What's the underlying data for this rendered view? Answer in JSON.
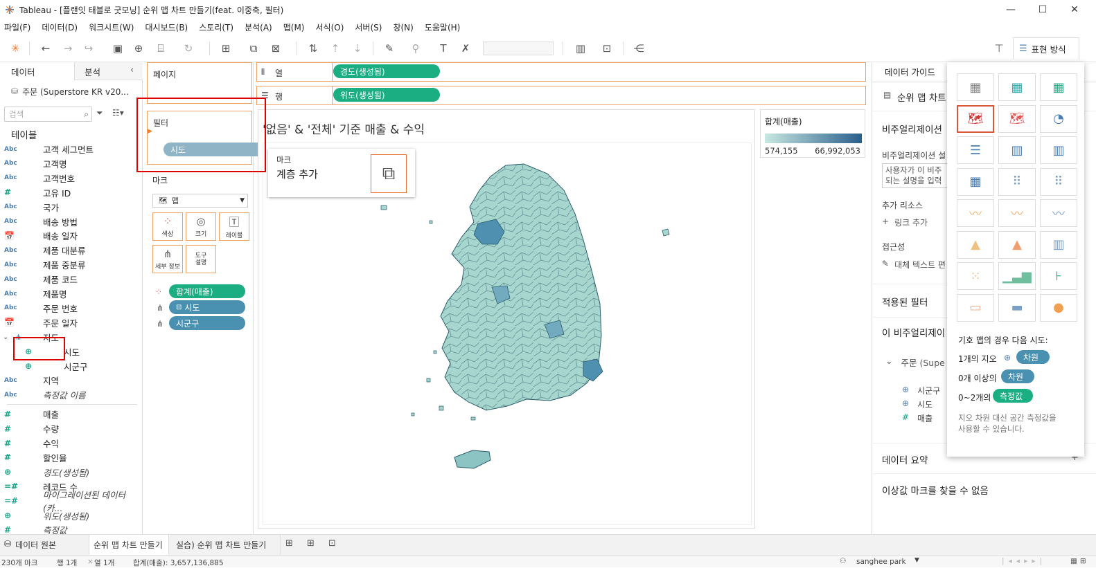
{
  "window": {
    "title": "Tableau - [플랜잇 태블로 굿모닝] 순위 맵 차트 만들기(feat. 이중축, 필터)"
  },
  "menu": [
    "파일(F)",
    "데이터(D)",
    "워크시트(W)",
    "대시보드(B)",
    "스토리(T)",
    "분석(A)",
    "맵(M)",
    "서식(O)",
    "서버(S)",
    "창(N)",
    "도움말(H)"
  ],
  "toolbar": {
    "show_me_label": "표현 방식"
  },
  "left_panel": {
    "tab_data": "데이터",
    "tab_analysis": "분석",
    "datasource": "주문 (Superstore KR v20...",
    "search_placeholder": "검색",
    "tables_title": "테이블",
    "fields": [
      {
        "icon": "Abc",
        "label": "고객 세그먼트"
      },
      {
        "icon": "Abc",
        "label": "고객명"
      },
      {
        "icon": "Abc",
        "label": "고객번호"
      },
      {
        "icon": "#",
        "label": "고유 ID"
      },
      {
        "icon": "Abc",
        "label": "국가"
      },
      {
        "icon": "Abc",
        "label": "배송 방법"
      },
      {
        "icon": "calendar",
        "label": "배송 일자"
      },
      {
        "icon": "Abc",
        "label": "제품 대분류"
      },
      {
        "icon": "Abc",
        "label": "제품 중분류"
      },
      {
        "icon": "Abc",
        "label": "제품 코드"
      },
      {
        "icon": "Abc",
        "label": "제품명"
      },
      {
        "icon": "Abc",
        "label": "주문 번호"
      },
      {
        "icon": "calendar",
        "label": "주문 일자"
      }
    ],
    "hierarchy": {
      "label": "지도",
      "children": [
        "시도",
        "시군구"
      ]
    },
    "fields2": [
      {
        "icon": "Abc",
        "label": "지역",
        "italic": false
      },
      {
        "icon": "Abc",
        "label": "측정값 이름",
        "italic": true
      }
    ],
    "measures": [
      {
        "icon": "#",
        "label": "매출",
        "italic": false
      },
      {
        "icon": "#",
        "label": "수량",
        "italic": false
      },
      {
        "icon": "#",
        "label": "수익",
        "italic": false
      },
      {
        "icon": "#",
        "label": "할인율",
        "italic": false
      },
      {
        "icon": "globe",
        "label": "경도(생성됨)",
        "italic": true
      },
      {
        "icon": "=#",
        "label": "레코드 수",
        "italic": false
      },
      {
        "icon": "=#",
        "label": "마이그레이션된 데이터(카...",
        "italic": true
      },
      {
        "icon": "globe",
        "label": "위도(생성됨)",
        "italic": true
      },
      {
        "icon": "#",
        "label": "측정값",
        "italic": true
      }
    ]
  },
  "cards": {
    "pages": "페이지",
    "filters": "필터",
    "filter_pill": "시도",
    "marks": "마크",
    "mark_type": "맵",
    "mark_buttons": [
      "색상",
      "크기",
      "레이블",
      "세부 정보",
      "도구 설명"
    ],
    "mark_pills": [
      "합계(매출)",
      "시도",
      "시군구"
    ]
  },
  "shelves": {
    "columns_label": "열",
    "columns_pill": "경도(생성됨)",
    "rows_label": "행",
    "rows_pill": "위도(생성됨)"
  },
  "view": {
    "title": "'없음' & '전체' 기준 매출 & 수익",
    "layer_popup_title": "마크",
    "layer_popup_text": "계층 추가",
    "legend_title": "합계(매출)",
    "legend_min": "574,155",
    "legend_max": "66,992,053",
    "legend_colors": {
      "low": "#c8e8e0",
      "high": "#2a5e8c"
    }
  },
  "data_guide": {
    "title": "데이터 가이드",
    "chart_name": "순위 맵 차트",
    "viz_section": "비주얼리제이션",
    "viz_desc_label": "비주얼리제이션 설",
    "viz_desc_placeholder": "사용자가 이 비주\n되는 설명을 입력",
    "add_resource": "추가 리소스",
    "add_link": "링크 추가",
    "accessibility": "접근성",
    "alt_text": "대체 텍스트 편",
    "applied_filters": "적용된 필터",
    "this_viz": "이 비주얼리제이",
    "source": "주문 (Supe",
    "source_fields": [
      "시군구",
      "시도",
      "매출"
    ],
    "data_summary": "데이터 요약",
    "no_outliers": "이상값 마크를 찾을 수 없음"
  },
  "show_me": {
    "hint_title": "기호 맵의 경우 다음 시도:",
    "row1_prefix": "1개의 지오",
    "row1_pill": "차원",
    "row2_prefix": "0개 이상의",
    "row2_pill": "차원",
    "row3_prefix": "0~2개의",
    "row3_pill": "측정값",
    "hint_note": "지오 차원 대신 공간 측정값을\n사용할 수 있습니다."
  },
  "bottom_tabs": [
    "데이터 원본",
    "순위 맵 차트 만들기",
    "실습) 순위 맵 차트 만들기"
  ],
  "status": {
    "marks": "230개 마크",
    "rows": "행 1개",
    "cols": "열 1개",
    "sum": "합계(매출): 3,657,136,885",
    "user": "sanghee park"
  }
}
